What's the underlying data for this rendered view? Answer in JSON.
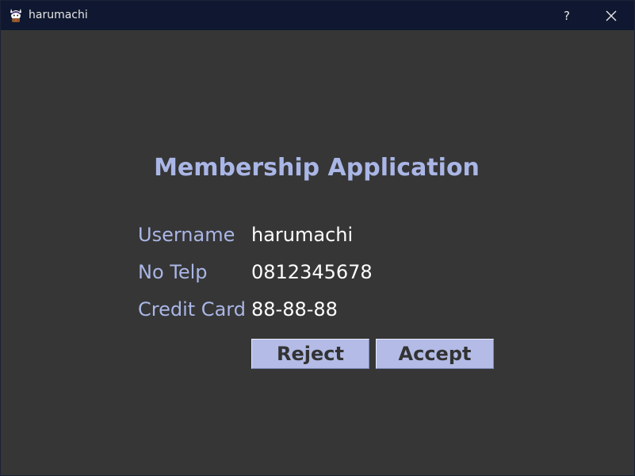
{
  "window": {
    "title": "harumachi",
    "help_label": "?"
  },
  "form": {
    "heading": "Membership Application",
    "fields": [
      {
        "label": "Username",
        "value": "harumachi"
      },
      {
        "label": "No Telp",
        "value": "0812345678"
      },
      {
        "label": "Credit Card",
        "value": "88-88-88"
      }
    ],
    "buttons": {
      "reject": "Reject",
      "accept": "Accept"
    }
  },
  "colors": {
    "background": "#363636",
    "titlebar": "#0f1830",
    "accent_text": "#aab6e6",
    "button_bg": "#b3bbe6"
  },
  "icons": {
    "app": "cat-mascot-icon",
    "help": "question-icon",
    "close": "close-icon"
  }
}
